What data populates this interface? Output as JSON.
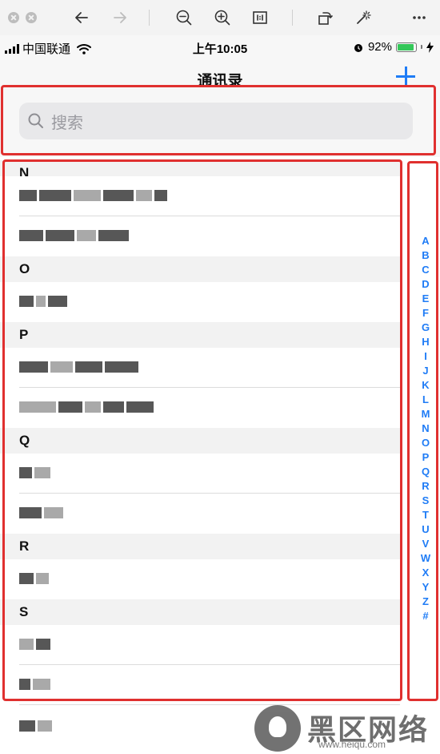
{
  "viewer": {
    "tools": [
      "back-icon",
      "forward-icon",
      "zoom-out-icon",
      "zoom-in-icon",
      "actual-size-icon",
      "rotate-icon",
      "magic-wand-icon",
      "more-icon"
    ]
  },
  "status": {
    "carrier": "中国联通",
    "time": "上午10:05",
    "battery": "92%"
  },
  "nav": {
    "title": "通讯录"
  },
  "search": {
    "placeholder": "搜索"
  },
  "sections": [
    {
      "letter": "N"
    },
    {
      "letter": "O"
    },
    {
      "letter": "P"
    },
    {
      "letter": "Q"
    },
    {
      "letter": "R"
    },
    {
      "letter": "S"
    }
  ],
  "index": [
    "A",
    "B",
    "C",
    "D",
    "E",
    "F",
    "G",
    "H",
    "I",
    "J",
    "K",
    "L",
    "M",
    "N",
    "O",
    "P",
    "Q",
    "R",
    "S",
    "T",
    "U",
    "V",
    "W",
    "X",
    "Y",
    "Z",
    "#"
  ],
  "watermark": {
    "text": "黑区网络",
    "url": "www.heiqu.com"
  }
}
